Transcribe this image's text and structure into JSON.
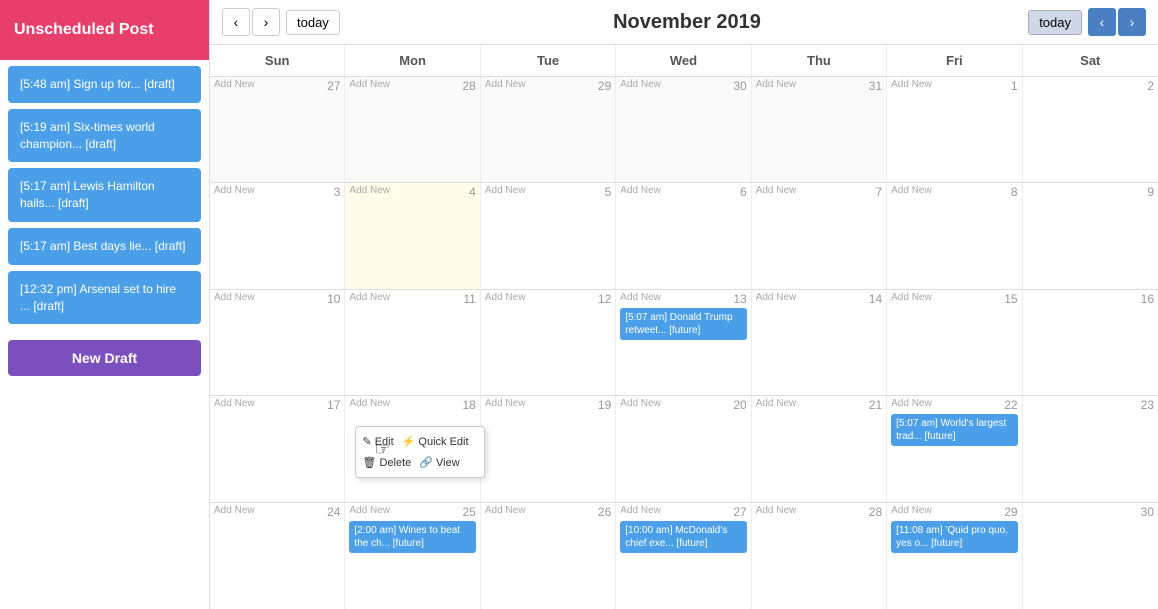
{
  "sidebar": {
    "header": "Unscheduled Post",
    "drafts": [
      "[5:48 am] Sign up for... [draft]",
      "[5:19 am] Six-times world champion... [draft]",
      "[5:17 am] Lewis Hamilton hails... [draft]",
      "[5:17 am] Best days lie... [draft]",
      "[12:32 pm] Arsenal set to hire ... [draft]"
    ],
    "new_draft_label": "New Draft"
  },
  "header": {
    "month_title": "November 2019",
    "today_label": "today",
    "today_right_label": "today",
    "prev_icon": "‹",
    "next_icon": "›"
  },
  "day_headers": [
    "Sun",
    "Mon",
    "Tue",
    "Wed",
    "Thu",
    "Fri",
    "Sat"
  ],
  "weeks": [
    {
      "cells": [
        {
          "date": 27,
          "other": true,
          "add_new": true
        },
        {
          "date": 28,
          "other": true,
          "add_new": true
        },
        {
          "date": 29,
          "other": true,
          "add_new": true
        },
        {
          "date": 30,
          "other": true,
          "add_new": true
        },
        {
          "date": 31,
          "other": true,
          "add_new": true
        },
        {
          "date": 1,
          "add_new": true
        },
        {
          "date": 2
        }
      ]
    },
    {
      "cells": [
        {
          "date": 3,
          "add_new": true
        },
        {
          "date": 4,
          "today": true,
          "add_new": true
        },
        {
          "date": 5,
          "add_new": true
        },
        {
          "date": 6,
          "add_new": true
        },
        {
          "date": 7,
          "add_new": true
        },
        {
          "date": 8,
          "add_new": true
        },
        {
          "date": 9
        }
      ]
    },
    {
      "cells": [
        {
          "date": 10,
          "add_new": true
        },
        {
          "date": 11,
          "add_new": true
        },
        {
          "date": 12,
          "add_new": true
        },
        {
          "date": 13,
          "add_new": true,
          "events": [
            {
              "text": "[5:07 am] Donald Trump retweet... [future]",
              "color": "blue"
            }
          ]
        },
        {
          "date": 14,
          "add_new": true
        },
        {
          "date": 15,
          "add_new": true
        },
        {
          "date": 16
        }
      ]
    },
    {
      "cells": [
        {
          "date": 17,
          "add_new": true
        },
        {
          "date": 18,
          "add_new": true,
          "context_menu": true
        },
        {
          "date": 19,
          "add_new": true
        },
        {
          "date": 20,
          "add_new": true
        },
        {
          "date": 21,
          "add_new": true
        },
        {
          "date": 22,
          "add_new": true,
          "events": [
            {
              "text": "[5:07 am] World's largest trad... [future]",
              "color": "blue"
            }
          ]
        },
        {
          "date": 23
        }
      ]
    },
    {
      "cells": [
        {
          "date": 24,
          "add_new": true
        },
        {
          "date": 25,
          "add_new": true,
          "events": [
            {
              "text": "[2:00 am] Wines to beat the ch... [future]",
              "color": "blue"
            }
          ]
        },
        {
          "date": 26,
          "add_new": true
        },
        {
          "date": 27,
          "add_new": true,
          "events": [
            {
              "text": "[10:00 am] McDonald's chief exe... [future]",
              "color": "blue"
            }
          ]
        },
        {
          "date": 28,
          "add_new": true
        },
        {
          "date": 29,
          "add_new": true,
          "events": [
            {
              "text": "[11:08 am] 'Quid pro quo, yes o... [future]",
              "color": "blue"
            }
          ]
        },
        {
          "date": 30
        }
      ]
    }
  ],
  "context_menu": {
    "items": [
      "Edit",
      "Quick Edit",
      "Delete",
      "View"
    ],
    "icons": [
      "✎",
      "⚡",
      "🗑",
      "🔗"
    ]
  }
}
